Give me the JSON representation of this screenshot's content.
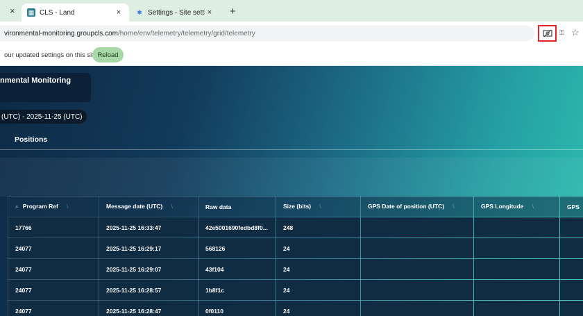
{
  "browser": {
    "tabs": [
      {
        "title": "CLS - Land",
        "favicon": "cls-logo-icon",
        "active": true
      },
      {
        "title": "Settings - Site settings",
        "favicon": "gear-icon",
        "active": false
      }
    ],
    "url_host": "vironmental-monitoring.groupcls.com",
    "url_path": "/home/env/telemetry/telemetry/grid/telemetry",
    "infobar_message": "our updated settings on this site",
    "reload_label": "Reload"
  },
  "app": {
    "title": "nmental Monitoring",
    "date_range": "(UTC) - 2025-11-25 (UTC)",
    "active_tab": "Positions"
  },
  "table": {
    "columns": [
      "Program Ref",
      "Message date (UTC)",
      "Raw data",
      "Size (bits)",
      "GPS Date of position (UTC)",
      "GPS Longitude",
      "GPS"
    ],
    "rows": [
      [
        "17766",
        "2025-11-25 16:33:47",
        "42e5001690fedbd8f0...",
        "248",
        "",
        "",
        ""
      ],
      [
        "24077",
        "2025-11-25 16:29:17",
        "568126",
        "24",
        "",
        "",
        ""
      ],
      [
        "24077",
        "2025-11-25 16:29:07",
        "43f104",
        "24",
        "",
        "",
        ""
      ],
      [
        "24077",
        "2025-11-25 16:28:57",
        "1b8f1c",
        "24",
        "",
        "",
        ""
      ],
      [
        "24077",
        "2025-11-25 16:28:47",
        "0f0110",
        "24",
        "",
        "",
        ""
      ]
    ]
  },
  "colors": {
    "highlight_box": "#e0242b",
    "reload_button": "#a8d8a8",
    "header_gradient_start": "#0d2a46",
    "header_gradient_end": "#2fbfb0"
  }
}
